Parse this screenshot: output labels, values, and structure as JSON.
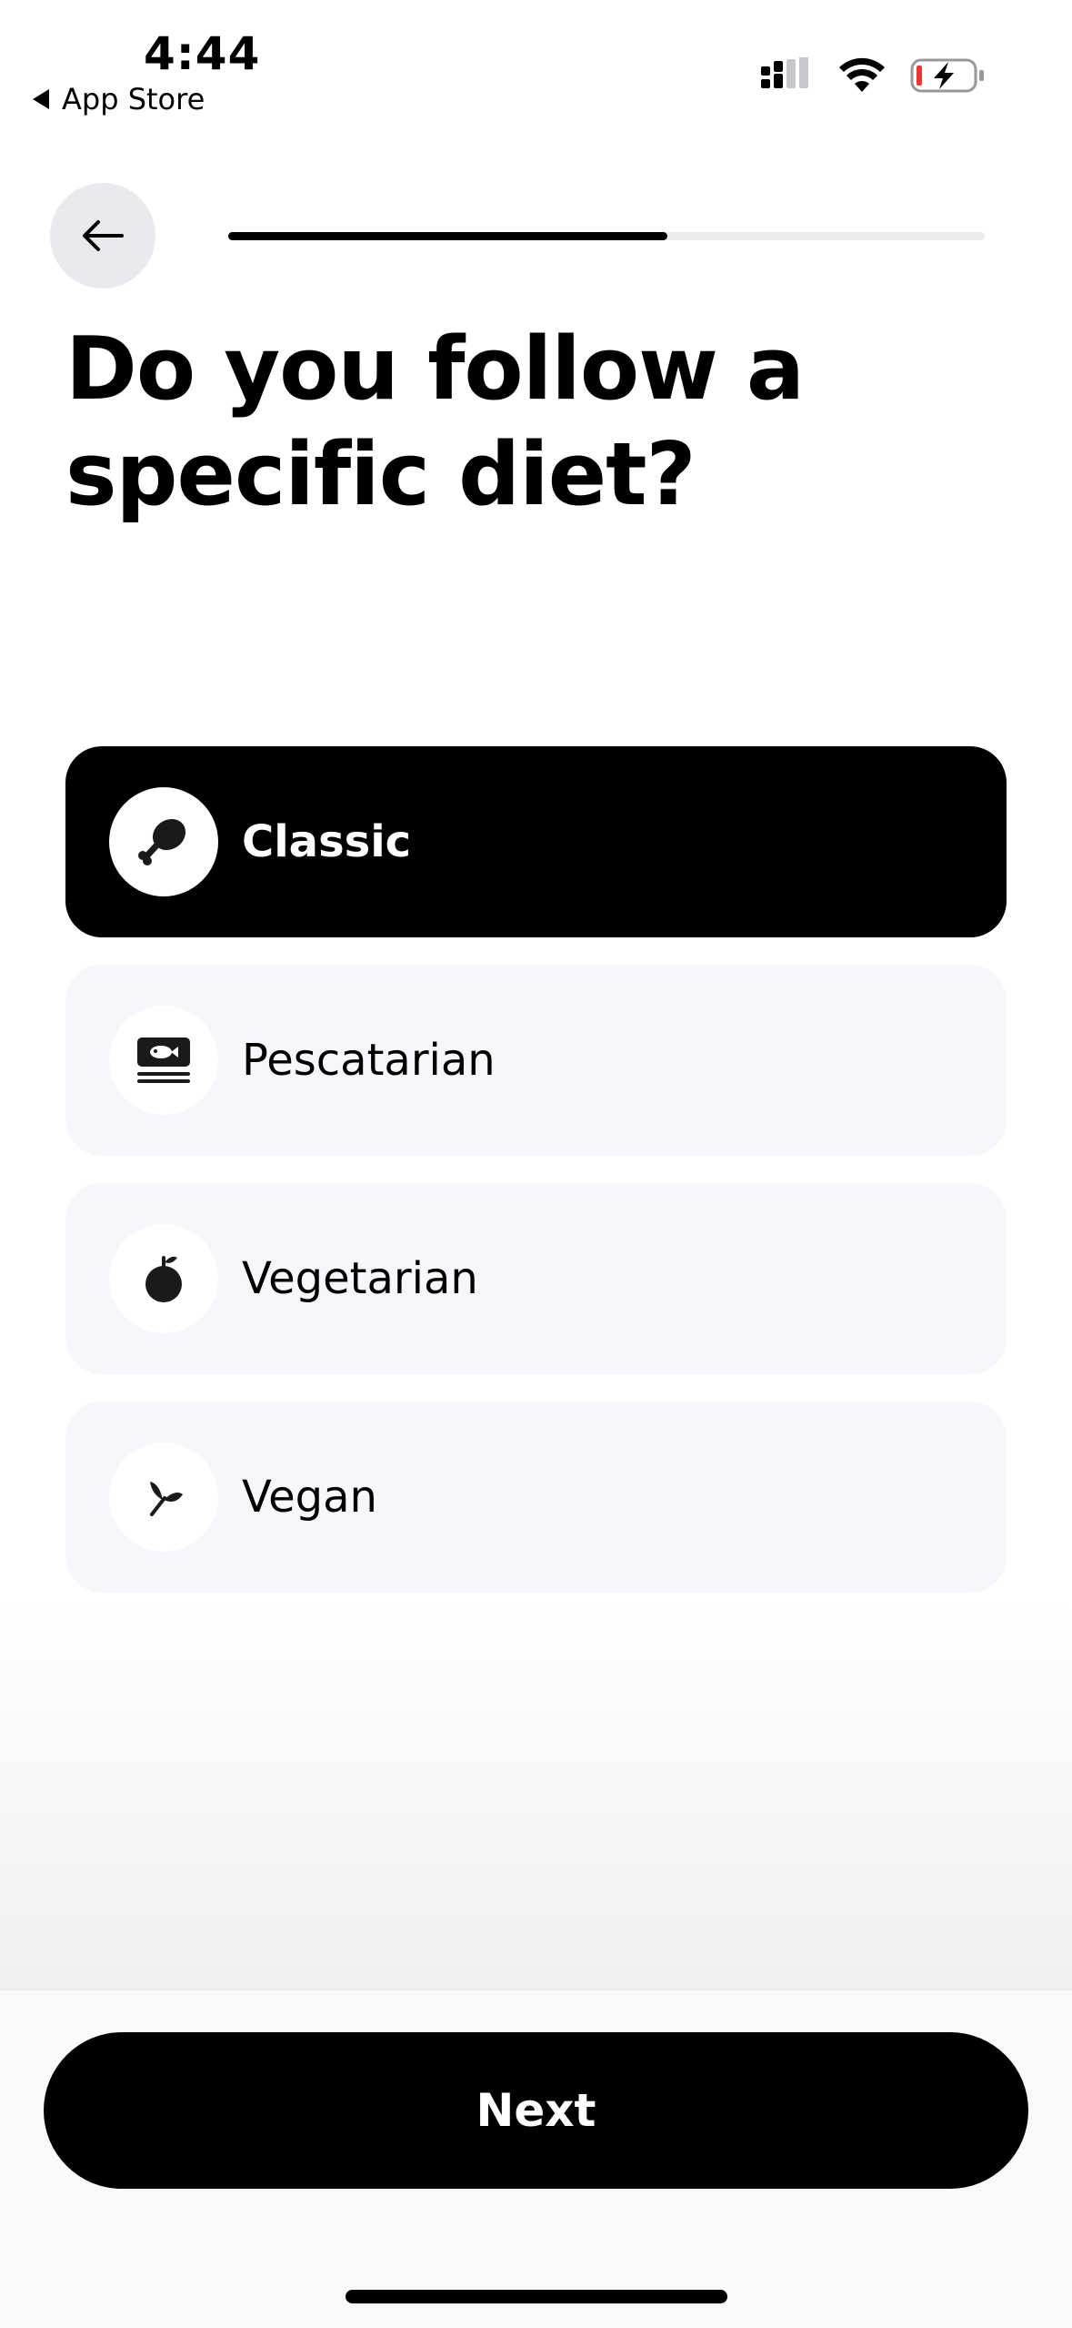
{
  "status_bar": {
    "time": "4:44",
    "back_app": "App Store"
  },
  "header": {
    "progress_fraction": 0.58
  },
  "question": {
    "title": "Do you follow a specific diet?"
  },
  "options": [
    {
      "label": "Classic",
      "icon": "drumstick-icon",
      "selected": true
    },
    {
      "label": "Pescatarian",
      "icon": "fish-icon",
      "selected": false
    },
    {
      "label": "Vegetarian",
      "icon": "apple-icon",
      "selected": false
    },
    {
      "label": "Vegan",
      "icon": "sprout-icon",
      "selected": false
    }
  ],
  "footer": {
    "next_label": "Next"
  },
  "colors": {
    "accent": "#000000",
    "option_bg": "#f7f7fb",
    "back_button_bg": "#e9e9ee",
    "battery_low": "#e53935"
  }
}
